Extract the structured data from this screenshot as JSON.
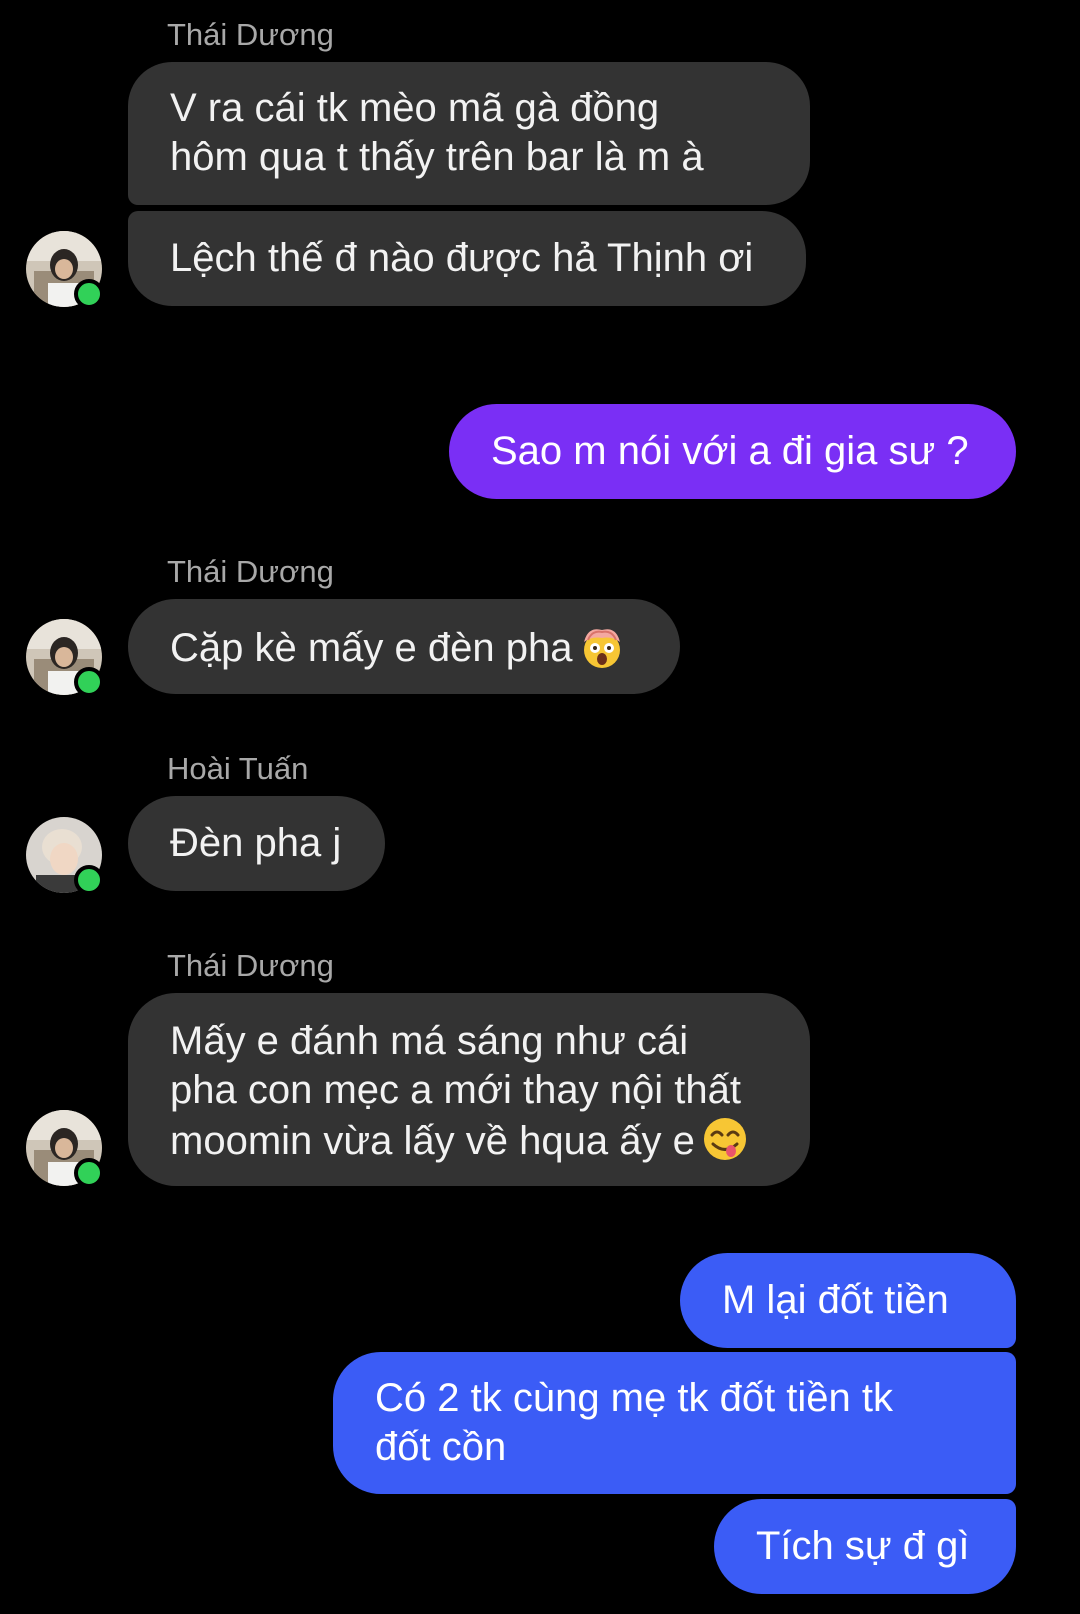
{
  "colors": {
    "incoming_bubble": "#333333",
    "outgoing_purple": "#7a2ff5",
    "outgoing_blue": "#3b5cf6",
    "online_dot": "#31d158",
    "sender_name": "#a8a8a8"
  },
  "messages": [
    {
      "sender": "Thái Dương",
      "lines": [
        "V ra cái tk mèo mã gà đồng",
        "hôm qua t thấy trên bar là m à"
      ]
    },
    {
      "text": "Lệch thế đ nào được hả Thịnh ơi"
    },
    {
      "text": "Sao m nói với a đi gia sư ?"
    },
    {
      "sender": "Thái Dương",
      "text": "Cặp kè mấy e đèn pha",
      "emoji": "exploding-head-emoji"
    },
    {
      "sender": "Hoài Tuấn",
      "text": "Đèn pha j"
    },
    {
      "sender": "Thái Dương",
      "lines": [
        "Mấy e đánh má sáng như cái",
        "pha con mẹc a mới thay nội thất",
        "moomin vừa lấy về hqua ấy e"
      ],
      "emoji": "yum-face-emoji"
    },
    {
      "text": "M lại đốt tiền"
    },
    {
      "lines": [
        "Có 2 tk cùng mẹ tk đốt tiền tk",
        "đốt cồn"
      ]
    },
    {
      "text": "Tích sự đ gì"
    }
  ]
}
